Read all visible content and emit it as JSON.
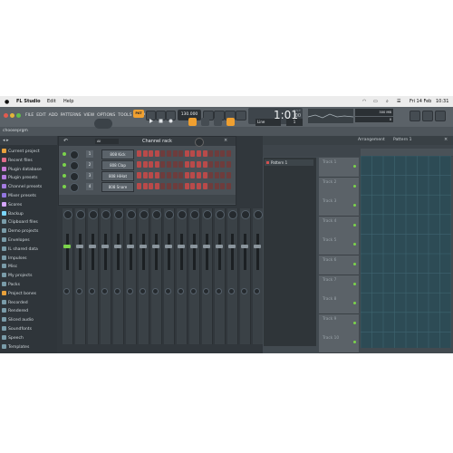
{
  "menubar": {
    "app_name": "FL Studio",
    "menus": [
      "Edit",
      "Help"
    ],
    "date": "Fri 14 Feb",
    "time": "10:31"
  },
  "toolbar": {
    "menu_items": [
      "FILE",
      "EDIT",
      "ADD",
      "PATTERNS",
      "VIEW",
      "OPTIONS",
      "TOOLS",
      "HELP"
    ],
    "pat_song": "PAT",
    "tempo": "130.000",
    "time_display": "1:01",
    "time_sub": ":00",
    "time_unit": "B:S:T",
    "snap": "Line",
    "pattern_number": "1",
    "cpu_mem": "300 MB",
    "poly": "0"
  },
  "hintbar": {
    "text": "chooseprgm"
  },
  "browser": {
    "items": [
      {
        "label": "Current project",
        "color": "#e9a13b"
      },
      {
        "label": "Recent files",
        "color": "#e06c8a"
      },
      {
        "label": "Plugin database",
        "color": "#c77ad6"
      },
      {
        "label": "Plugin presets",
        "color": "#b57ce0"
      },
      {
        "label": "Channel presets",
        "color": "#a37be0"
      },
      {
        "label": "Mixer presets",
        "color": "#9276e0"
      },
      {
        "label": "Scores",
        "color": "#d6a6ff"
      },
      {
        "label": "Backup",
        "color": "#7ad6ff"
      },
      {
        "label": "Clipboard files",
        "color": "#7a9ca9"
      },
      {
        "label": "Demo projects",
        "color": "#7a9ca9"
      },
      {
        "label": "Envelopes",
        "color": "#7a9ca9"
      },
      {
        "label": "IL shared data",
        "color": "#7a9ca9"
      },
      {
        "label": "Impulses",
        "color": "#7a9ca9"
      },
      {
        "label": "Misc",
        "color": "#7a9ca9"
      },
      {
        "label": "My projects",
        "color": "#7a9ca9"
      },
      {
        "label": "Packs",
        "color": "#7a9ca9"
      },
      {
        "label": "Project bones",
        "color": "#e9a13b"
      },
      {
        "label": "Recorded",
        "color": "#7a9ca9"
      },
      {
        "label": "Rendered",
        "color": "#7a9ca9"
      },
      {
        "label": "Sliced audio",
        "color": "#7a9ca9"
      },
      {
        "label": "Soundfonts",
        "color": "#7a9ca9"
      },
      {
        "label": "Speech",
        "color": "#7a9ca9"
      },
      {
        "label": "Templates",
        "color": "#7a9ca9"
      }
    ]
  },
  "channel_rack": {
    "title": "Channel rack",
    "filter": "All",
    "channels": [
      {
        "num": "1",
        "name": "808 Kick"
      },
      {
        "num": "2",
        "name": "808 Clap"
      },
      {
        "num": "3",
        "name": "808 HiHat"
      },
      {
        "num": "4",
        "name": "808 Snare"
      }
    ]
  },
  "playlist": {
    "title": "Arrangement",
    "subtitle": "Pattern 1",
    "picker_items": [
      "Pattern 1"
    ],
    "tracks": [
      "Track 1",
      "Track 2",
      "Track 3",
      "Track 4",
      "Track 5",
      "Track 6",
      "Track 7",
      "Track 8",
      "Track 9",
      "Track 10"
    ]
  },
  "colors": {
    "accent_orange": "#f0a030",
    "step_red": "#b94a4a",
    "step_dark": "#6e3c3c",
    "grid_teal": "#2d4b55",
    "fader_green": "#7bd34b"
  }
}
